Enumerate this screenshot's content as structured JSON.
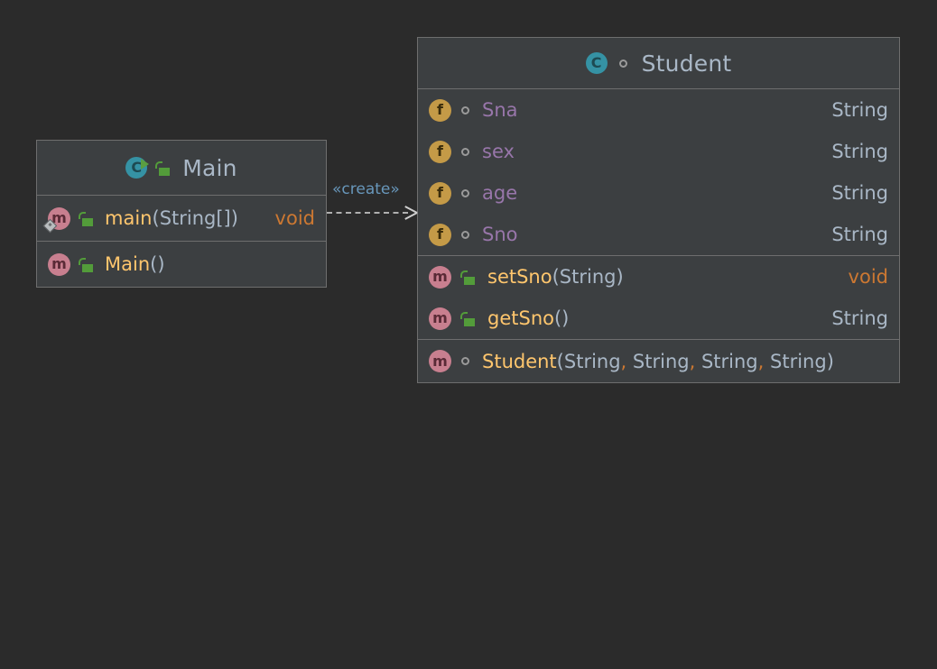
{
  "diagram": {
    "background": "#2b2b2b",
    "title": "UML class diagram"
  },
  "classes": [
    {
      "id": "main",
      "name": "Main",
      "class_icon": "class-runnable-icon",
      "visibility_icon": "unlock-icon",
      "sections": [
        {
          "id": "main-methods",
          "members": [
            {
              "kind": "method",
              "member_icon": "method-icon",
              "visibility_icon": "unlock-icon",
              "is_static": true,
              "name": "main",
              "params": [
                {
                  "type": "String[]"
                }
              ],
              "return_type": "void",
              "return_is_keyword": true
            }
          ]
        },
        {
          "id": "main-constructors",
          "members": [
            {
              "kind": "method",
              "member_icon": "method-icon",
              "visibility_icon": "unlock-icon",
              "is_static": false,
              "name": "Main",
              "params": [],
              "return_type": "",
              "return_is_keyword": false
            }
          ]
        }
      ]
    },
    {
      "id": "student",
      "name": "Student",
      "class_icon": "class-icon",
      "visibility_icon": "package-private-icon",
      "sections": [
        {
          "id": "student-fields",
          "members": [
            {
              "kind": "field",
              "member_icon": "field-icon",
              "visibility_icon": "package-private-icon",
              "name": "Sna",
              "return_type": "String",
              "return_is_keyword": false
            },
            {
              "kind": "field",
              "member_icon": "field-icon",
              "visibility_icon": "package-private-icon",
              "name": "sex",
              "return_type": "String",
              "return_is_keyword": false
            },
            {
              "kind": "field",
              "member_icon": "field-icon",
              "visibility_icon": "package-private-icon",
              "name": "age",
              "return_type": "String",
              "return_is_keyword": false
            },
            {
              "kind": "field",
              "member_icon": "field-icon",
              "visibility_icon": "package-private-icon",
              "name": "Sno",
              "return_type": "String",
              "return_is_keyword": false
            }
          ]
        },
        {
          "id": "student-methods",
          "members": [
            {
              "kind": "method",
              "member_icon": "method-icon",
              "visibility_icon": "unlock-icon",
              "is_static": false,
              "name": "setSno",
              "params": [
                {
                  "type": "String"
                }
              ],
              "return_type": "void",
              "return_is_keyword": true
            },
            {
              "kind": "method",
              "member_icon": "method-icon",
              "visibility_icon": "unlock-icon",
              "is_static": false,
              "name": "getSno",
              "params": [],
              "return_type": "String",
              "return_is_keyword": false
            }
          ]
        },
        {
          "id": "student-constructors",
          "members": [
            {
              "kind": "method",
              "member_icon": "method-icon",
              "visibility_icon": "package-private-icon",
              "is_static": false,
              "name": "Student",
              "params": [
                {
                  "type": "String"
                },
                {
                  "type": "String"
                },
                {
                  "type": "String"
                },
                {
                  "type": "String"
                }
              ],
              "return_type": "",
              "return_is_keyword": false
            }
          ]
        }
      ]
    }
  ],
  "connectors": [
    {
      "id": "create-dependency",
      "label": "«create»",
      "from": "Main",
      "to": "Student",
      "style": "dashed",
      "arrow": "open"
    }
  ],
  "colors": {
    "background": "#2b2b2b",
    "box_fill": "#3c3f41",
    "box_border": "#6e6e6e",
    "class_name": "#a9b7c6",
    "field_name": "#9876aa",
    "method_name": "#ffc66d",
    "type_text": "#a9b7c6",
    "keyword": "#cc7832",
    "connector_label": "#6897bb",
    "class_badge": "#3592a4",
    "field_badge": "#c49a47",
    "method_badge": "#c87f8f",
    "lock_green": "#539c3a"
  }
}
